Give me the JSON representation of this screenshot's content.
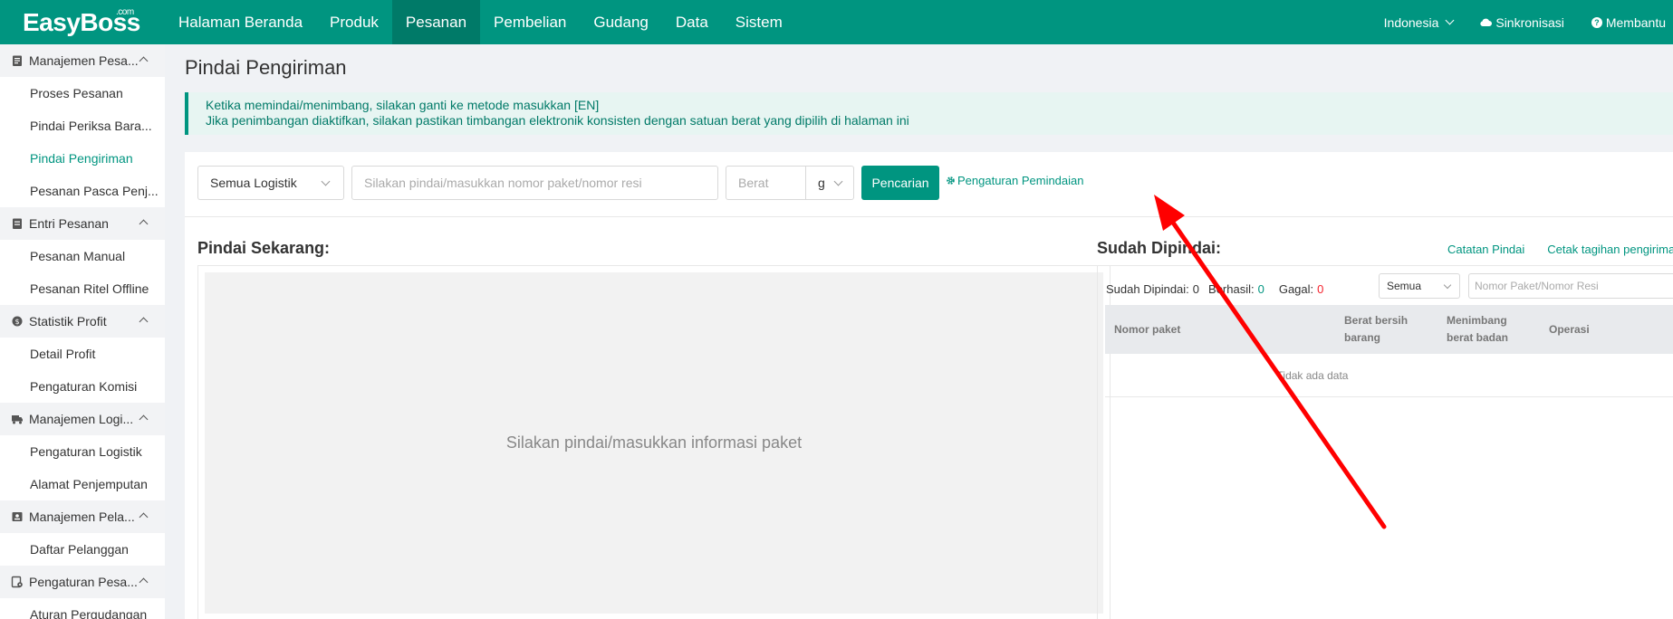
{
  "brand": {
    "name": "EasyBoss",
    "suffix": ".com"
  },
  "nav": [
    {
      "label": "Halaman Beranda"
    },
    {
      "label": "Produk"
    },
    {
      "label": "Pesanan"
    },
    {
      "label": "Pembelian"
    },
    {
      "label": "Gudang"
    },
    {
      "label": "Data"
    },
    {
      "label": "Sistem"
    }
  ],
  "top_right": {
    "language": "Indonesia",
    "sync": "Sinkronisasi",
    "help": "Membantu"
  },
  "sidebar": [
    {
      "label": "Manajemen Pesa..."
    },
    {
      "label": "Proses Pesanan"
    },
    {
      "label": "Pindai Periksa Bara..."
    },
    {
      "label": "Pindai Pengiriman"
    },
    {
      "label": "Pesanan Pasca Penj..."
    },
    {
      "label": "Entri Pesanan"
    },
    {
      "label": "Pesanan Manual"
    },
    {
      "label": "Pesanan Ritel Offline"
    },
    {
      "label": "Statistik Profit"
    },
    {
      "label": "Detail Profit"
    },
    {
      "label": "Pengaturan Komisi"
    },
    {
      "label": "Manajemen Logi..."
    },
    {
      "label": "Pengaturan Logistik"
    },
    {
      "label": "Alamat Penjemputan"
    },
    {
      "label": "Manajemen Pela..."
    },
    {
      "label": "Daftar Pelanggan"
    },
    {
      "label": "Pengaturan Pesa..."
    },
    {
      "label": "Aturan Pergudangan"
    }
  ],
  "page": {
    "title": "Pindai Pengiriman",
    "notice_line1": "Ketika memindai/menimbang, silakan ganti ke metode masukkan [EN]",
    "notice_line2": "Jika penimbangan diaktifkan, silakan pastikan timbangan elektronik konsisten dengan satuan berat yang dipilih di halaman ini"
  },
  "search": {
    "logistics_selected": "Semua Logistik",
    "package_placeholder": "Silakan pindai/masukkan nomor paket/nomor resi",
    "weight_placeholder": "Berat",
    "unit_selected": "g",
    "search_button": "Pencarian",
    "settings_link": "Pengaturan Pemindaian"
  },
  "scan_now": {
    "title": "Pindai Sekarang:",
    "placeholder": "Silakan pindai/masukkan informasi paket"
  },
  "scanned": {
    "title": "Sudah Dipindai:",
    "log_link": "Catatan Pindai",
    "print_link": "Cetak tagihan pengiriman",
    "stats": {
      "scanned_label": "Sudah Dipindai:",
      "scanned_value": "0",
      "success_label": "Berhasil:",
      "success_value": "0",
      "failed_label": "Gagal:",
      "failed_value": "0"
    },
    "filter_selected": "Semua",
    "filter_placeholder": "Nomor Paket/Nomor Resi",
    "columns": {
      "package_no": "Nomor paket",
      "net_weight_1": "Berat bersih",
      "net_weight_2": "barang",
      "weigh_1": "Menimbang",
      "weigh_2": "berat badan",
      "operation": "Operasi"
    },
    "empty_text": "Tidak ada data"
  },
  "colors": {
    "brand": "#009580",
    "brand_dark": "#007a68",
    "failed": "#f5222d",
    "arrow": "#ff0000"
  }
}
